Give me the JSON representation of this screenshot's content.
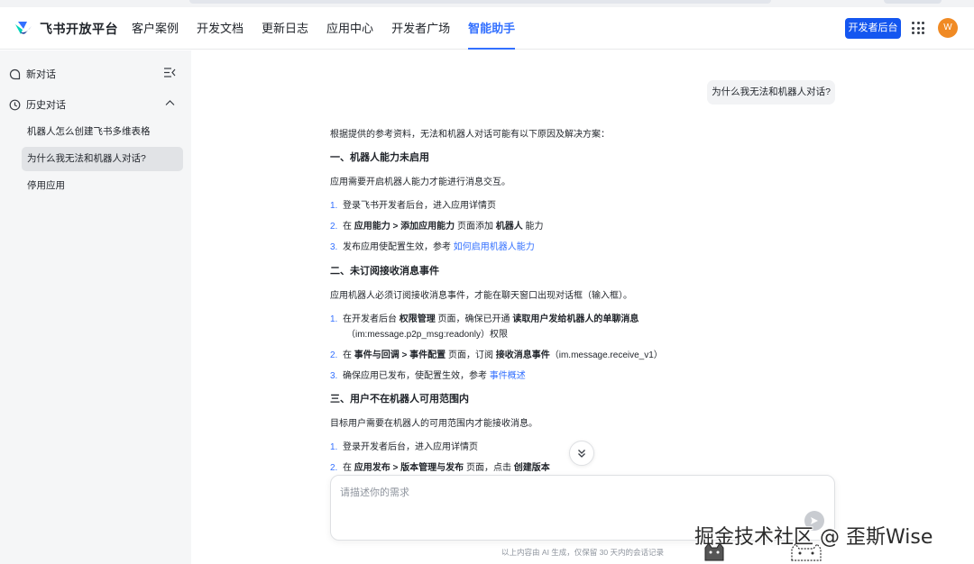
{
  "header": {
    "logo_text": "飞书开放平台",
    "nav": [
      {
        "label": "客户案例",
        "active": false
      },
      {
        "label": "开发文档",
        "active": false
      },
      {
        "label": "更新日志",
        "active": false
      },
      {
        "label": "应用中心",
        "active": false
      },
      {
        "label": "开发者广场",
        "active": false
      },
      {
        "label": "智能助手",
        "active": true
      }
    ],
    "dev_console_label": "开发者后台",
    "avatar_letter": "W"
  },
  "sidebar": {
    "new_chat_label": "新对话",
    "history_label": "历史对话",
    "history_items": [
      {
        "label": "机器人怎么创建飞书多维表格",
        "active": false
      },
      {
        "label": "为什么我无法和机器人对话?",
        "active": true
      },
      {
        "label": "停用应用",
        "active": false
      }
    ]
  },
  "chat": {
    "user_question": "为什么我无法和机器人对话?",
    "answer": {
      "intro": "根据提供的参考资料，无法和机器人对话可能有以下原因及解决方案：",
      "s1_title": "一、机器人能力未启用",
      "s1_desc": "应用需要开启机器人能力才能进行消息交互。",
      "s1_i1": "登录飞书开发者后台，进入应用详情页",
      "s1_i2_a": "在 ",
      "s1_i2_b": "应用能力 > 添加应用能力",
      "s1_i2_c": " 页面添加 ",
      "s1_i2_d": "机器人",
      "s1_i2_e": " 能力",
      "s1_i3_a": "发布应用使配置生效，参考 ",
      "s1_i3_link": "如何启用机器人能力",
      "s2_title": "二、未订阅接收消息事件",
      "s2_desc": "应用机器人必须订阅接收消息事件，才能在聊天窗口出现对话框（输入框）。",
      "s2_i1_a": "在开发者后台 ",
      "s2_i1_b": "权限管理",
      "s2_i1_c": " 页面，确保已开通 ",
      "s2_i1_d": "读取用户发给机器人的单聊消息",
      "s2_i1_e": "（im:message.p2p_msg:readonly）权限",
      "s2_i2_a": "在 ",
      "s2_i2_b": "事件与回调 > 事件配置",
      "s2_i2_c": " 页面，订阅 ",
      "s2_i2_d": "接收消息事件",
      "s2_i2_e": "（im.message.receive_v1）",
      "s2_i3_a": "确保应用已发布，使配置生效，参考 ",
      "s2_i3_link": "事件概述",
      "s3_title": "三、用户不在机器人可用范围内",
      "s3_desc": "目标用户需要在机器人的可用范围内才能接收消息。",
      "s3_i1": "登录开发者后台，进入应用详情页",
      "s3_i2_a": "在 ",
      "s3_i2_b": "应用发布 > 版本管理与发布",
      "s3_i2_c": " 页面，点击 ",
      "s3_i2_d": "创建版本"
    },
    "input_placeholder": "请描述你的需求",
    "disclaimer": "以上内容由 AI 生成，仅保留 30 天内的会话记录"
  },
  "watermark": "掘金技术社区 @ 歪斯Wise",
  "colors": {
    "accent": "#3370ff",
    "primary_button": "#1456f0",
    "avatar": "#f08a24"
  }
}
